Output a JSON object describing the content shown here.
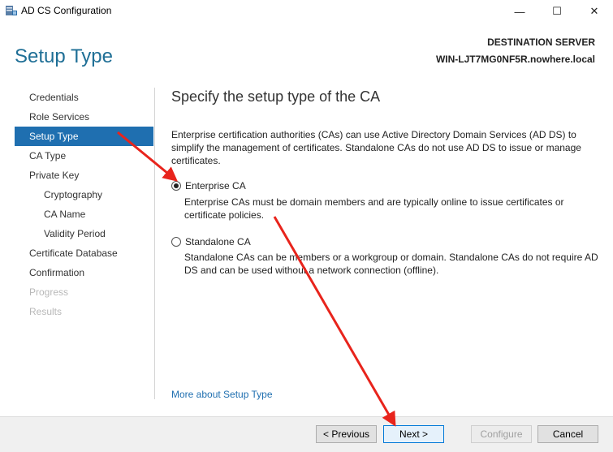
{
  "window": {
    "title": "AD CS Configuration",
    "min_glyph": "—",
    "max_glyph": "☐",
    "close_glyph": "✕"
  },
  "header": {
    "title": "Setup Type",
    "destination_label": "DESTINATION SERVER",
    "destination_name": "WIN-LJT7MG0NF5R.nowhere.local"
  },
  "sidebar": {
    "items": [
      {
        "label": "Credentials"
      },
      {
        "label": "Role Services"
      },
      {
        "label": "Setup Type"
      },
      {
        "label": "CA Type"
      },
      {
        "label": "Private Key"
      },
      {
        "label": "Cryptography"
      },
      {
        "label": "CA Name"
      },
      {
        "label": "Validity Period"
      },
      {
        "label": "Certificate Database"
      },
      {
        "label": "Confirmation"
      },
      {
        "label": "Progress"
      },
      {
        "label": "Results"
      }
    ]
  },
  "main": {
    "heading": "Specify the setup type of the CA",
    "intro": "Enterprise certification authorities (CAs) can use Active Directory Domain Services (AD DS) to simplify the management of certificates. Standalone CAs do not use AD DS to issue or manage certificates.",
    "enterprise": {
      "label": "Enterprise CA",
      "description": "Enterprise CAs must be domain members and are typically online to issue certificates or certificate policies."
    },
    "standalone": {
      "label": "Standalone CA",
      "description": "Standalone CAs can be members or a workgroup or domain. Standalone CAs do not require AD DS and can be used without a network connection (offline)."
    },
    "more_link": "More about Setup Type"
  },
  "footer": {
    "previous": "< Previous",
    "next": "Next >",
    "configure": "Configure",
    "cancel": "Cancel"
  },
  "colors": {
    "accent": "#1f6fb0",
    "title": "#1f6f96",
    "annotation": "#e8241c"
  }
}
